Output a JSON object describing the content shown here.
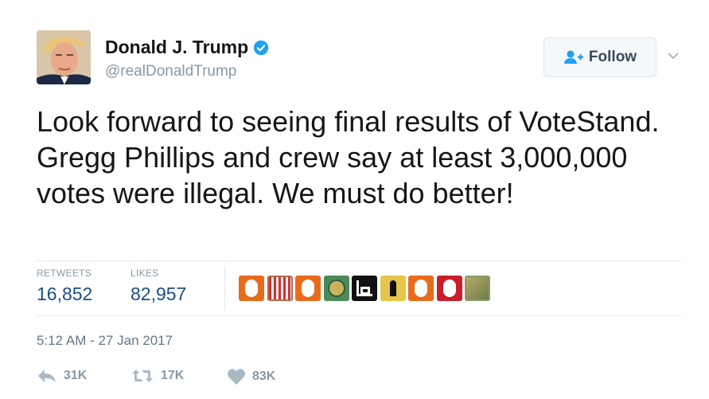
{
  "user": {
    "name": "Donald J. Trump",
    "handle": "@realDonaldTrump",
    "verified": true
  },
  "follow_button": {
    "label": "Follow"
  },
  "tweet": {
    "text": "Look forward to seeing final results of VoteStand. Gregg Phillips and crew say at least 3,000,000 votes were illegal. We must do better!",
    "timestamp": "5:12 AM - 27 Jan 2017"
  },
  "stats": {
    "retweets_label": "RETWEETS",
    "retweets_value": "16,852",
    "likes_label": "LIKES",
    "likes_value": "82,957"
  },
  "likers": [
    {
      "icon": "orange-avatar-icon",
      "color": "#e86b1c"
    },
    {
      "icon": "flag-avatar-icon",
      "color": "#b8694a"
    },
    {
      "icon": "orange-avatar-icon",
      "color": "#e86b1c"
    },
    {
      "icon": "seal-avatar-icon",
      "color": "#4d8a5a"
    },
    {
      "icon": "letter-b-avatar-icon",
      "color": "#111111"
    },
    {
      "icon": "silhouette-avatar-icon",
      "color": "#e5c64a"
    },
    {
      "icon": "orange-avatar-icon",
      "color": "#e86b1c"
    },
    {
      "icon": "red-avatar-icon",
      "color": "#c81e2a"
    },
    {
      "icon": "photo-avatar-icon",
      "color": "#8a9a6a"
    }
  ],
  "actions": {
    "reply_count": "31K",
    "retweet_count": "17K",
    "like_count": "83K"
  },
  "colors": {
    "accent_blue": "#1da1f2",
    "stat_value": "#1b4f86",
    "muted": "#8899a6"
  }
}
